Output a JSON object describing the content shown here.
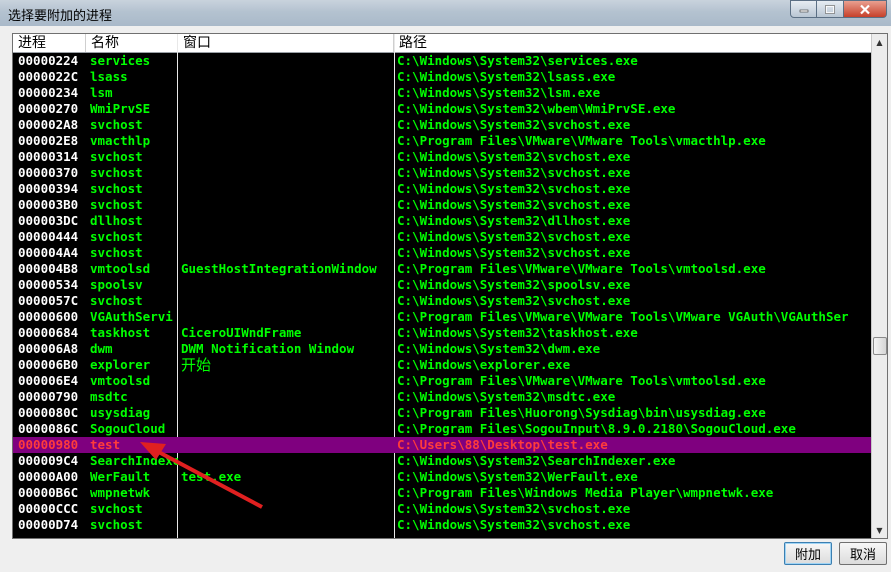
{
  "window": {
    "title": "选择要附加的进程"
  },
  "columns": [
    "进程",
    "名称",
    "窗口",
    "路径"
  ],
  "rows": [
    {
      "pid": "00000224",
      "name": "services",
      "window": "",
      "path": "C:\\Windows\\System32\\services.exe"
    },
    {
      "pid": "0000022C",
      "name": "lsass",
      "window": "",
      "path": "C:\\Windows\\System32\\lsass.exe"
    },
    {
      "pid": "00000234",
      "name": "lsm",
      "window": "",
      "path": "C:\\Windows\\System32\\lsm.exe"
    },
    {
      "pid": "00000270",
      "name": "WmiPrvSE",
      "window": "",
      "path": "C:\\Windows\\System32\\wbem\\WmiPrvSE.exe"
    },
    {
      "pid": "000002A8",
      "name": "svchost",
      "window": "",
      "path": "C:\\Windows\\System32\\svchost.exe"
    },
    {
      "pid": "000002E8",
      "name": "vmacthlp",
      "window": "",
      "path": "C:\\Program Files\\VMware\\VMware Tools\\vmacthlp.exe"
    },
    {
      "pid": "00000314",
      "name": "svchost",
      "window": "",
      "path": "C:\\Windows\\System32\\svchost.exe"
    },
    {
      "pid": "00000370",
      "name": "svchost",
      "window": "",
      "path": "C:\\Windows\\System32\\svchost.exe"
    },
    {
      "pid": "00000394",
      "name": "svchost",
      "window": "",
      "path": "C:\\Windows\\System32\\svchost.exe"
    },
    {
      "pid": "000003B0",
      "name": "svchost",
      "window": "",
      "path": "C:\\Windows\\System32\\svchost.exe"
    },
    {
      "pid": "000003DC",
      "name": "dllhost",
      "window": "",
      "path": "C:\\Windows\\System32\\dllhost.exe"
    },
    {
      "pid": "00000444",
      "name": "svchost",
      "window": "",
      "path": "C:\\Windows\\System32\\svchost.exe"
    },
    {
      "pid": "000004A4",
      "name": "svchost",
      "window": "",
      "path": "C:\\Windows\\System32\\svchost.exe"
    },
    {
      "pid": "000004B8",
      "name": "vmtoolsd",
      "window": "GuestHostIntegrationWindow",
      "path": "C:\\Program Files\\VMware\\VMware Tools\\vmtoolsd.exe"
    },
    {
      "pid": "00000534",
      "name": "spoolsv",
      "window": "",
      "path": "C:\\Windows\\System32\\spoolsv.exe"
    },
    {
      "pid": "0000057C",
      "name": "svchost",
      "window": "",
      "path": "C:\\Windows\\System32\\svchost.exe"
    },
    {
      "pid": "00000600",
      "name": "VGAuthServi",
      "window": "",
      "path": "C:\\Program Files\\VMware\\VMware Tools\\VMware VGAuth\\VGAuthSer"
    },
    {
      "pid": "00000684",
      "name": "taskhost",
      "window": "CiceroUIWndFrame",
      "path": "C:\\Windows\\System32\\taskhost.exe"
    },
    {
      "pid": "000006A8",
      "name": "dwm",
      "window": "DWM Notification Window",
      "path": "C:\\Windows\\System32\\dwm.exe"
    },
    {
      "pid": "000006B0",
      "name": "explorer",
      "window": "开始",
      "path": "C:\\Windows\\explorer.exe"
    },
    {
      "pid": "000006E4",
      "name": "vmtoolsd",
      "window": "",
      "path": "C:\\Program Files\\VMware\\VMware Tools\\vmtoolsd.exe"
    },
    {
      "pid": "00000790",
      "name": "msdtc",
      "window": "",
      "path": "C:\\Windows\\System32\\msdtc.exe"
    },
    {
      "pid": "0000080C",
      "name": "usysdiag",
      "window": "",
      "path": "C:\\Program Files\\Huorong\\Sysdiag\\bin\\usysdiag.exe"
    },
    {
      "pid": "0000086C",
      "name": "SogouCloud",
      "window": "",
      "path": "C:\\Program Files\\SogouInput\\8.9.0.2180\\SogouCloud.exe"
    },
    {
      "pid": "00000980",
      "name": "test",
      "window": "",
      "path": "C:\\Users\\88\\Desktop\\test.exe",
      "selected": true
    },
    {
      "pid": "000009C4",
      "name": "SearchIndexer",
      "window": "",
      "path": "C:\\Windows\\System32\\SearchIndexer.exe"
    },
    {
      "pid": "00000A00",
      "name": "WerFault",
      "window": "test.exe",
      "path": "C:\\Windows\\System32\\WerFault.exe"
    },
    {
      "pid": "00000B6C",
      "name": "wmpnetwk",
      "window": "",
      "path": "C:\\Program Files\\Windows Media Player\\wmpnetwk.exe"
    },
    {
      "pid": "00000CCC",
      "name": "svchost",
      "window": "",
      "path": "C:\\Windows\\System32\\svchost.exe"
    },
    {
      "pid": "00000D74",
      "name": "svchost",
      "window": "",
      "path": "C:\\Windows\\System32\\svchost.exe"
    }
  ],
  "buttons": {
    "attach": "附加",
    "cancel": "取消"
  },
  "colors": {
    "text": "#00ff00",
    "pid": "#ffffff",
    "background": "#000000",
    "selection_bg": "#7f007f",
    "selection_text": "#ff3b3b",
    "annotation_arrow": "#e02020"
  },
  "icons": {
    "minimize": "minimize-icon",
    "maximize": "maximize-icon",
    "close": "close-icon",
    "scroll_up": "scroll-up-icon",
    "scroll_down": "scroll-down-icon"
  }
}
